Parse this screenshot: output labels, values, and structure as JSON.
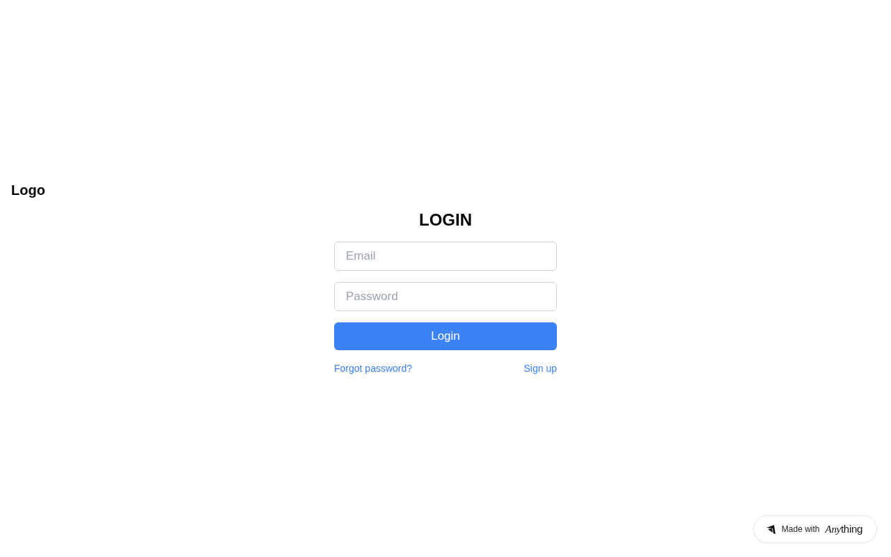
{
  "header": {
    "logo": "Logo"
  },
  "form": {
    "title": "LOGIN",
    "fields": [
      {
        "placeholder": "Email"
      },
      {
        "placeholder": "Password"
      }
    ],
    "submit": "Login",
    "links": [
      "Forgot password?",
      "Sign up"
    ]
  },
  "badge": {
    "label": "Made with",
    "brand": {
      "italic_part": "Any",
      "plain_part": "thing"
    }
  }
}
